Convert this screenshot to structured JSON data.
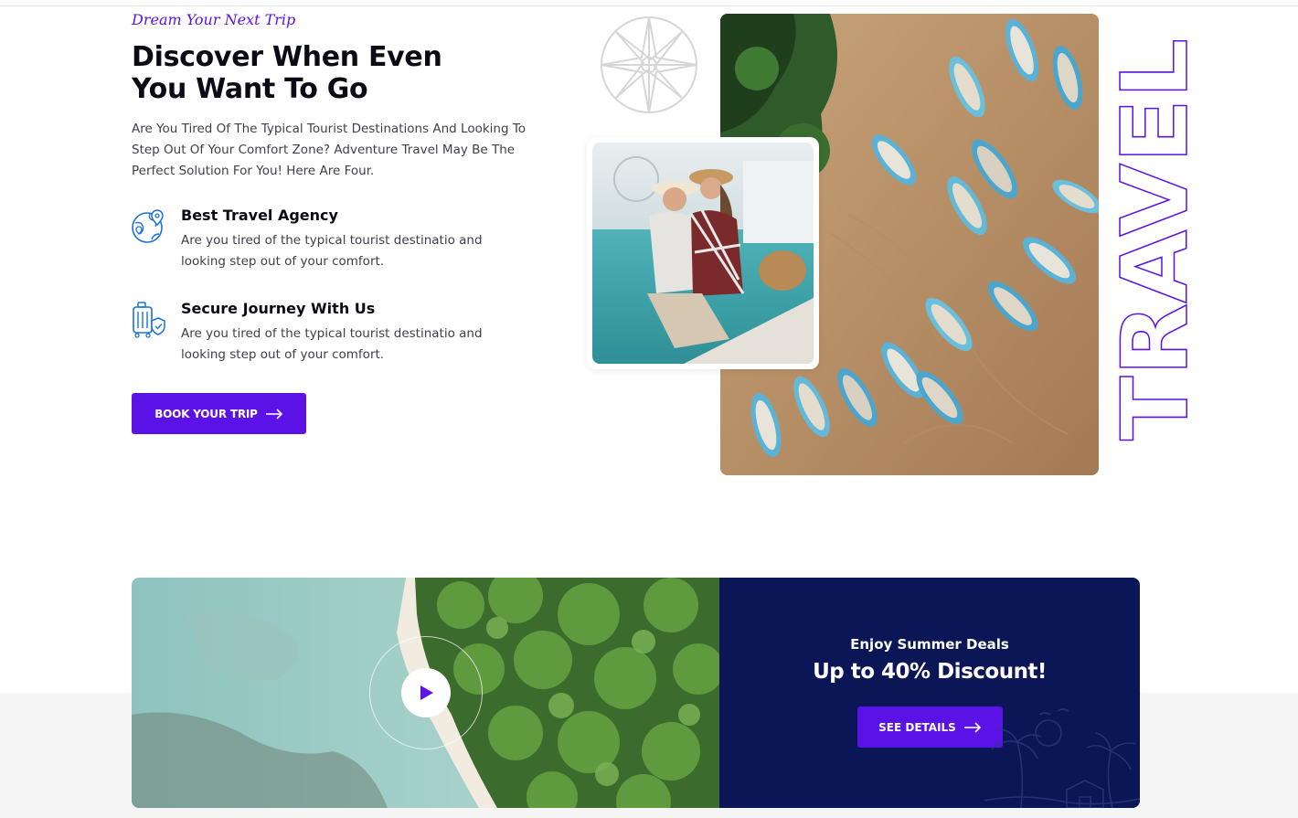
{
  "hero": {
    "tagline": "Dream Your Next Trip",
    "title_line1": "Discover When Even",
    "title_line2": "You Want To Go",
    "intro": "Are You Tired Of The Typical Tourist Destinations And Looking To Step Out Of Your Comfort Zone? Adventure Travel May Be The Perfect Solution For You! Here Are Four.",
    "features": [
      {
        "title": "Best Travel Agency",
        "description": "Are you tired of the typical tourist destinatio and looking step out of your comfort.",
        "icon": "globe-location-icon"
      },
      {
        "title": "Secure Journey With Us",
        "description": "Are you tired of the typical tourist destinatio and looking step out of your comfort.",
        "icon": "luggage-shield-icon"
      }
    ],
    "book_button": "BOOK YOUR TRIP",
    "side_word": "TRAVEL"
  },
  "promo": {
    "subtitle": "Enjoy Summer Deals",
    "title": "Up to 40% Discount!",
    "button": "SEE DETAILS"
  },
  "colors": {
    "accent": "#5a12e6",
    "navy": "#0b1657",
    "heading": "#0b0b16",
    "body_text": "#3f3f4a"
  }
}
